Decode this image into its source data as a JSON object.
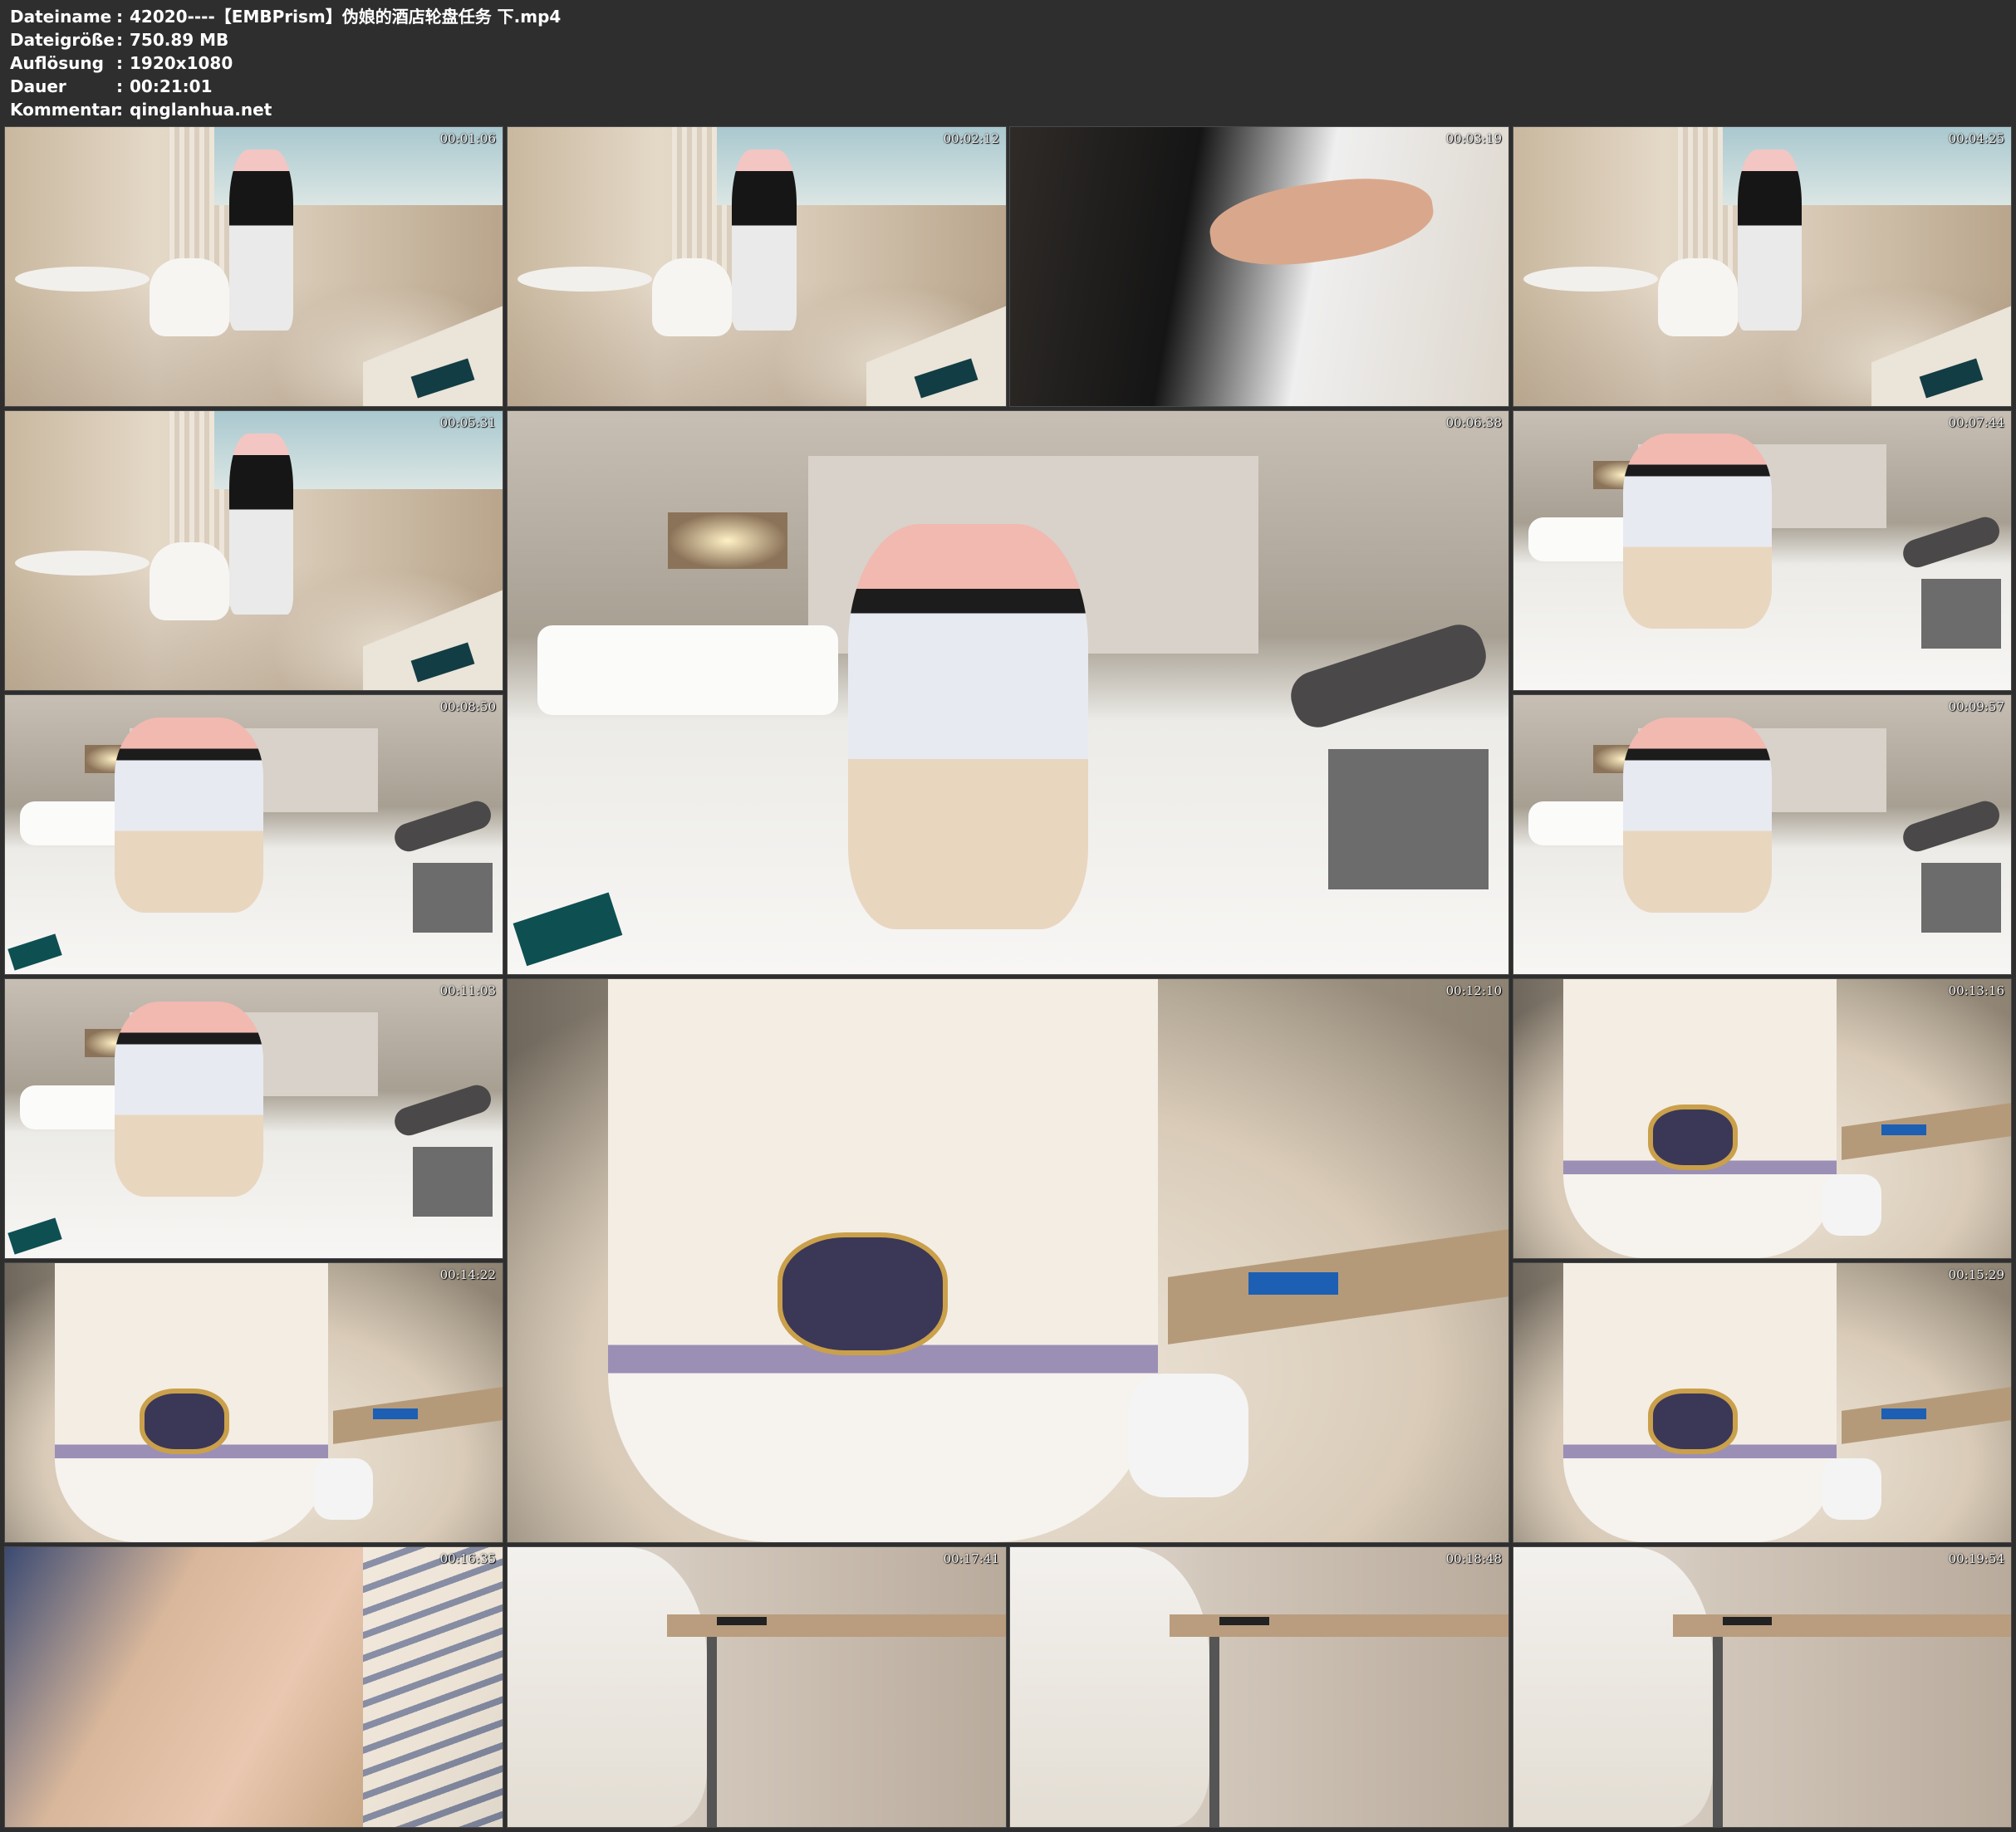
{
  "header": {
    "rows": [
      {
        "key": "Dateiname",
        "value": "42020----【EMBPrism】伪娘的酒店轮盘任务 下.mp4"
      },
      {
        "key": "Dateigröße",
        "value": "750.89 MB"
      },
      {
        "key": "Auflösung",
        "value": "1920x1080"
      },
      {
        "key": "Dauer",
        "value": "00:21:01"
      },
      {
        "key": "Kommentar",
        "value": "qinglanhua.net"
      }
    ],
    "separator": ":"
  },
  "thumbnails": [
    {
      "time": "00:01:06",
      "scene": "room"
    },
    {
      "time": "00:02:12",
      "scene": "room"
    },
    {
      "time": "00:03:19",
      "scene": "closeup"
    },
    {
      "time": "00:04:25",
      "scene": "room"
    },
    {
      "time": "00:05:31",
      "scene": "room"
    },
    {
      "time": "00:06:38",
      "scene": "bed-large"
    },
    {
      "time": "00:07:44",
      "scene": "bed"
    },
    {
      "time": "00:08:50",
      "scene": "bed"
    },
    {
      "time": "00:09:57",
      "scene": "bed"
    },
    {
      "time": "00:11:03",
      "scene": "bed"
    },
    {
      "time": "00:12:10",
      "scene": "dress-large"
    },
    {
      "time": "00:13:16",
      "scene": "dress"
    },
    {
      "time": "00:14:22",
      "scene": "dress"
    },
    {
      "time": "00:15:29",
      "scene": "dress"
    },
    {
      "time": "00:16:35",
      "scene": "fingers"
    },
    {
      "time": "00:17:41",
      "scene": "desk"
    },
    {
      "time": "00:18:48",
      "scene": "desk"
    },
    {
      "time": "00:19:54",
      "scene": "desk"
    }
  ],
  "colors": {
    "background": "#2e2e2e",
    "header_text": "#ffffff",
    "timestamp_text": "#f4f4f4"
  }
}
